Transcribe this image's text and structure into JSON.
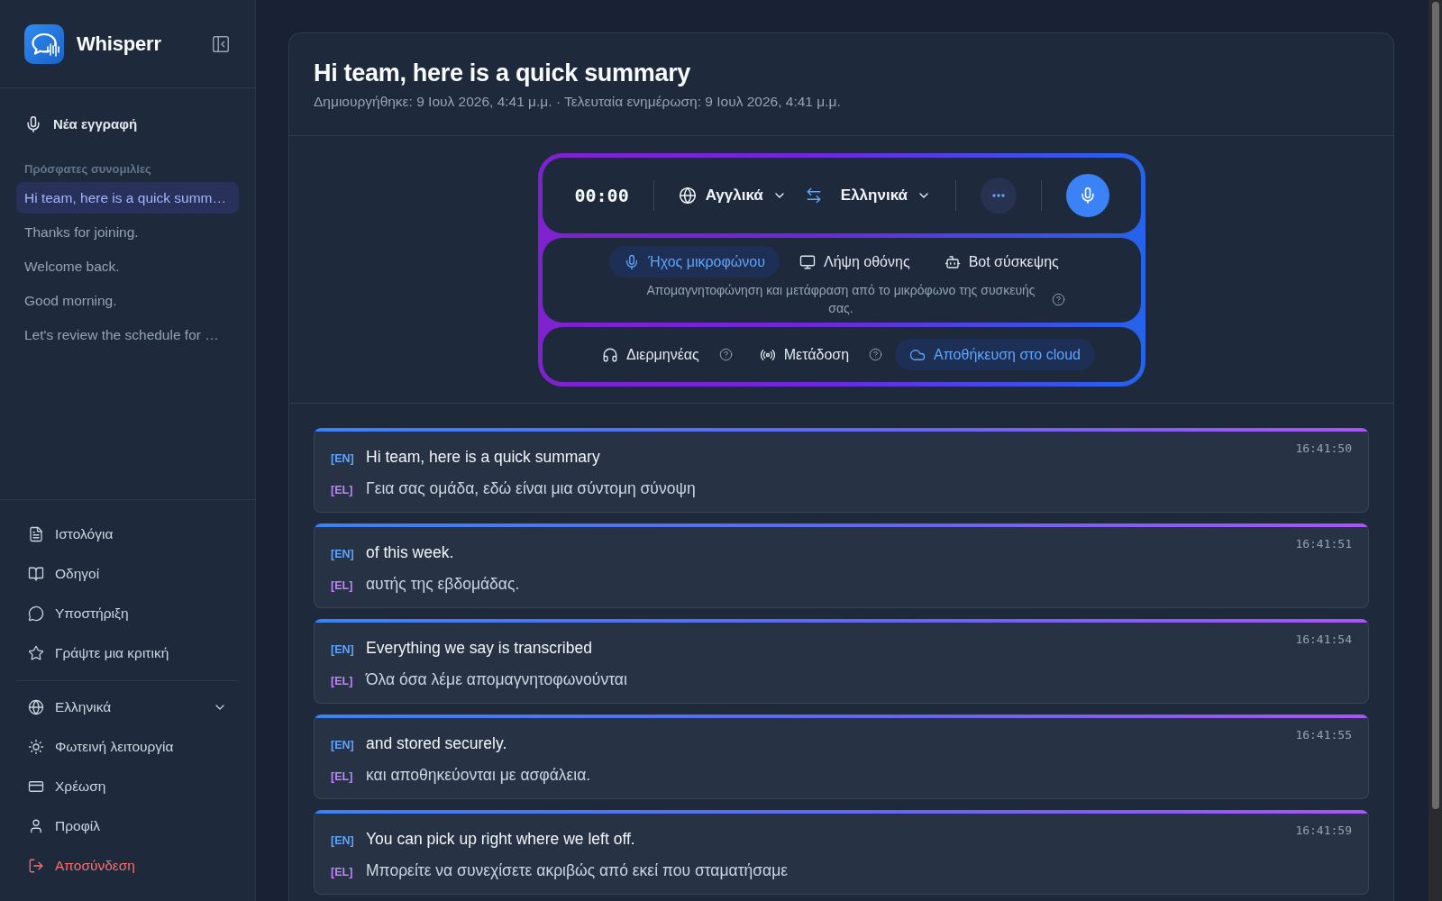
{
  "sidebar": {
    "brand": "Whisperr",
    "new_recording": "Νέα εγγραφή",
    "recent_label": "Πρόσφατες συνομιλίες",
    "recent": [
      {
        "title": "Hi team, here is a quick summ…",
        "selected": true
      },
      {
        "title": "Thanks for joining.",
        "selected": false
      },
      {
        "title": "Welcome back.",
        "selected": false
      },
      {
        "title": "Good morning.",
        "selected": false
      },
      {
        "title": "Let's review the schedule for …",
        "selected": false
      }
    ],
    "links": [
      "Ιστολόγια",
      "Οδηγοί",
      "Υποστήριξη",
      "Γράψτε μια κριτική"
    ],
    "language": {
      "label": "Ελληνικά",
      "expanded": false
    },
    "account": [
      {
        "label": "Φωτεινή λειτουργία",
        "kind": "link"
      },
      {
        "label": "Χρέωση",
        "kind": "link"
      },
      {
        "label": "Προφίλ",
        "kind": "link"
      },
      {
        "label": "Αποσύνδεση",
        "kind": "danger"
      }
    ]
  },
  "conversation": {
    "title": "Hi team, here is a quick summary",
    "meta": "Δημιουργήθηκε: 9 Ιουλ 2026, 4:41 μ.μ. · Τελευταία ενημέρωση: 9 Ιουλ 2026, 4:41 μ.μ."
  },
  "recorder": {
    "timer": "00:00",
    "source_language": "Αγγλικά",
    "target_language": "Ελληνικά",
    "sources": [
      {
        "label": "Ήχος μικροφώνου",
        "selected": true
      },
      {
        "label": "Λήψη οθόνης",
        "selected": false
      },
      {
        "label": "Bot σύσκεψης",
        "selected": false
      }
    ],
    "source_description": "Απομαγνητοφώνηση και μετάφραση από το μικρόφωνο της συσκευής σας.",
    "options": [
      {
        "label": "Διερμηνέας",
        "on": false,
        "help": true
      },
      {
        "label": "Μετάδοση",
        "on": false,
        "help": true
      },
      {
        "label": "Αποθήκευση στο cloud",
        "on": true,
        "help": false
      }
    ]
  },
  "transcript": [
    {
      "source_tag": "[EN]",
      "source_text": "Hi team, here is a quick summary",
      "target_tag": "[EL]",
      "target_text": "Γεια σας ομάδα, εδώ είναι μια σύντομη σύνοψη",
      "time": "16:41:50"
    },
    {
      "source_tag": "[EN]",
      "source_text": "of this week.",
      "target_tag": "[EL]",
      "target_text": "αυτής της εβδομάδας.",
      "time": "16:41:51"
    },
    {
      "source_tag": "[EN]",
      "source_text": "Everything we say is transcribed",
      "target_tag": "[EL]",
      "target_text": "Όλα όσα λέμε απομαγνητοφωνούνται",
      "time": "16:41:54"
    },
    {
      "source_tag": "[EN]",
      "source_text": "and stored securely.",
      "target_tag": "[EL]",
      "target_text": "και αποθηκεύονται με ασφάλεια.",
      "time": "16:41:55"
    },
    {
      "source_tag": "[EN]",
      "source_text": "You can pick up right where we left off.",
      "target_tag": "[EL]",
      "target_text": "Μπορείτε να συνεχίσετε ακριβώς από εκεί που σταματήσαμε",
      "time": "16:41:59"
    }
  ]
}
